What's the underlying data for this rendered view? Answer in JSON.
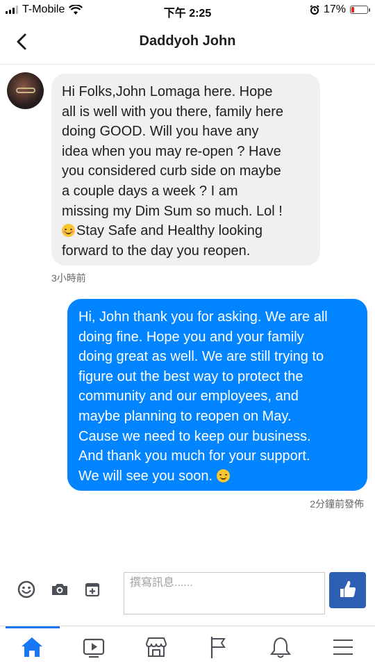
{
  "status_bar": {
    "carrier": "T-Mobile",
    "time": "下午 2:25",
    "battery_percent": "17%",
    "battery_level": 0.17
  },
  "header": {
    "back_icon": "chevron-left-icon",
    "title": "Daddyoh John"
  },
  "messages": [
    {
      "direction": "incoming",
      "lines": [
        "Hi Folks,John Lomaga here. Hope",
        "all is well with you there, family here",
        "doing GOOD. Will you have any",
        "idea when you may re-open ? Have",
        "you considered curb side on maybe",
        "a couple days a week ? I am",
        "missing my Dim Sum so much. Lol !",
        "Stay Safe and Healthy looking",
        "forward to the day you reopen."
      ],
      "emoji": "smiling-face-icon",
      "timestamp": "3小時前"
    },
    {
      "direction": "outgoing",
      "lines": [
        "Hi, John thank you for asking. We are all",
        "doing fine. Hope you and your family",
        "doing great as well. We are still trying to",
        "figure out the best way to protect the",
        "community and our employees, and",
        "maybe planning to reopen on May.",
        "Cause we need to keep our business.",
        "And thank you much for your support.",
        "We will see you soon."
      ],
      "emoji": "smiley-icon",
      "timestamp": "2分鐘前發佈"
    }
  ],
  "composer": {
    "placeholder": "撰寫訊息......",
    "value": "",
    "icons": [
      "emoji-icon",
      "camera-icon",
      "add-attachment-icon"
    ],
    "send_icon": "thumbs-up-icon",
    "send_color": "#2d5fb3"
  },
  "bottom_nav": {
    "items": [
      "home-icon",
      "video-icon",
      "marketplace-icon",
      "flag-icon",
      "bell-icon",
      "menu-icon"
    ],
    "active": "home-icon",
    "accent_color": "#1877f2"
  },
  "colors": {
    "outgoing_bubble": "#0084ff",
    "incoming_bubble": "#f0f0f0"
  }
}
